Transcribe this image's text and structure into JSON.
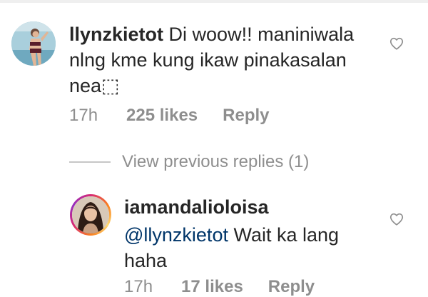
{
  "comments": [
    {
      "username": "llynzkietot",
      "text": "Di woow!! maniniwala nlng kme kung ikaw pinakasalan nea⬚",
      "time": "17h",
      "likes": "225 likes",
      "reply_label": "Reply",
      "avatar_icon": "profile-photo-woman-swimsuit",
      "heart_icon": "heart-outline-icon"
    }
  ],
  "view_previous_replies": "View previous replies (1)",
  "reply": {
    "username": "iamandalioloisa",
    "mention": "@llynzkietot",
    "text": " Wait ka lang haha",
    "time": "17h",
    "likes": "17 likes",
    "reply_label": "Reply",
    "avatar_icon": "profile-photo-woman",
    "story_ring_colors": [
      "#d62976",
      "#fa7e1e",
      "#feda75",
      "#962fbf"
    ],
    "heart_icon": "heart-outline-icon"
  },
  "colors": {
    "text": "#262626",
    "secondary": "#8e8e8e",
    "mention": "#003569"
  }
}
